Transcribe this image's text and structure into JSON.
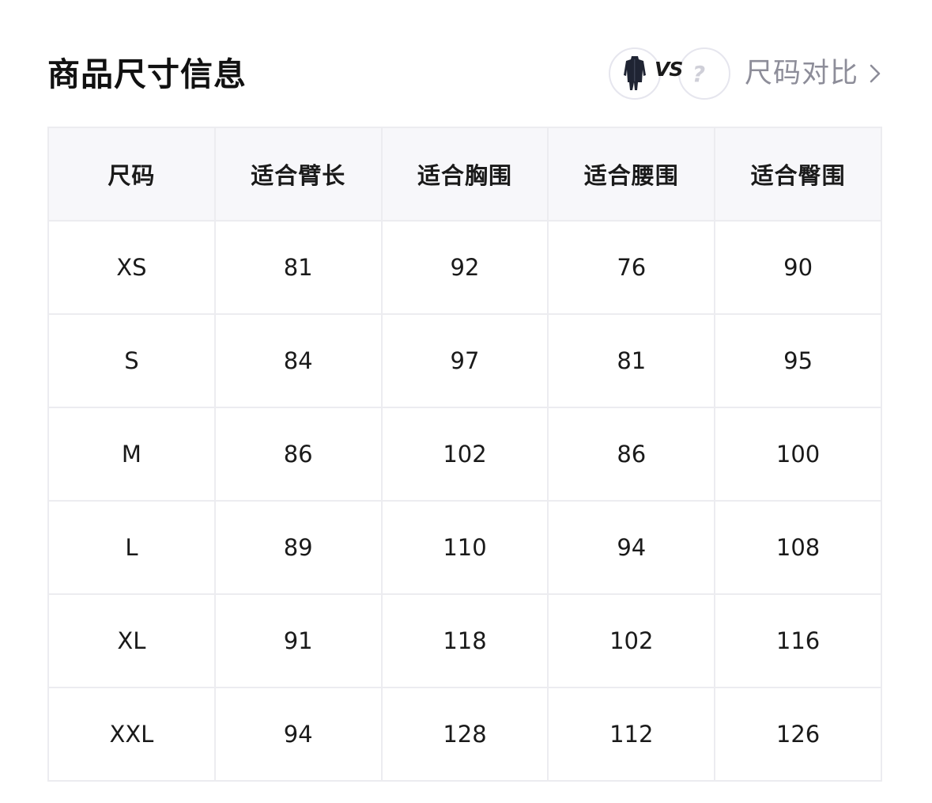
{
  "page_title": "商品尺寸信息",
  "compare": {
    "vs_text": "VS",
    "unknown_mark": "?",
    "label": "尺码对比",
    "product_icon": "jacket-thumbnail-icon",
    "chevron_icon": "chevron-right-icon"
  },
  "table": {
    "columns": [
      "尺码",
      "适合臂长",
      "适合胸围",
      "适合腰围",
      "适合臀围"
    ],
    "rows": [
      [
        "XS",
        "81",
        "92",
        "76",
        "90"
      ],
      [
        "S",
        "84",
        "97",
        "81",
        "95"
      ],
      [
        "M",
        "86",
        "102",
        "86",
        "100"
      ],
      [
        "L",
        "89",
        "110",
        "94",
        "108"
      ],
      [
        "XL",
        "91",
        "118",
        "102",
        "116"
      ],
      [
        "XXL",
        "94",
        "128",
        "112",
        "126"
      ]
    ]
  },
  "colors": {
    "header_bg": "#f7f7fa",
    "border": "#ececf0",
    "muted_text": "#8d8d99",
    "product_color": "#1f2433"
  }
}
